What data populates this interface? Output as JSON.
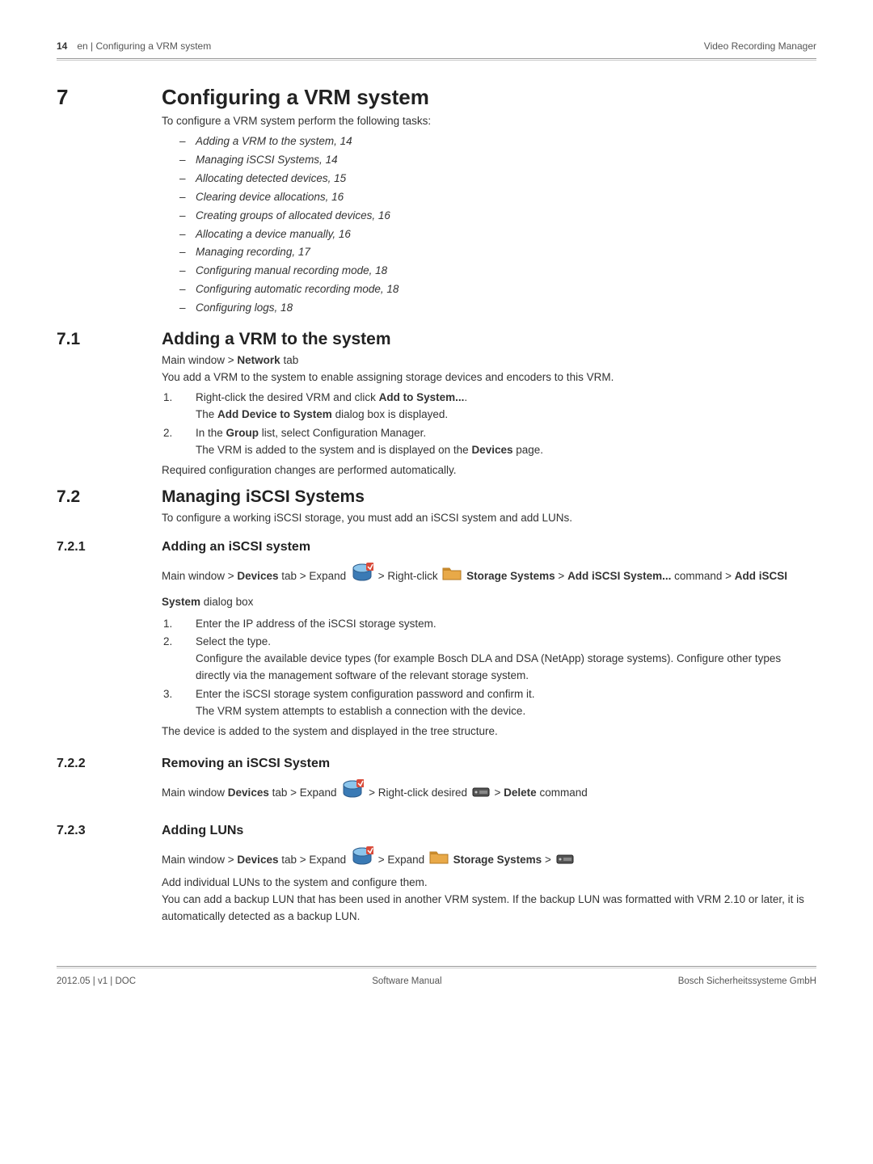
{
  "header": {
    "page_num": "14",
    "left_text": "en | Configuring a VRM system",
    "right_text": "Video Recording Manager"
  },
  "chapter": {
    "num": "7",
    "title": "Configuring a VRM system",
    "intro": "To configure a VRM system perform the following tasks:",
    "tasks": [
      "Adding a VRM to the system, 14",
      "Managing iSCSI Systems, 14",
      "Allocating detected devices, 15",
      "Clearing device allocations, 16",
      "Creating groups of allocated devices, 16",
      "Allocating a device manually, 16",
      "Managing recording, 17",
      "Configuring manual recording mode, 18",
      "Configuring automatic recording mode, 18",
      "Configuring logs, 18"
    ]
  },
  "s71": {
    "num": "7.1",
    "title": "Adding a VRM to the system",
    "path_pre": "Main window > ",
    "path_bold": "Network",
    "path_post": " tab",
    "p1": "You add a VRM to the system to enable assigning storage devices and encoders to this VRM.",
    "li1a": "Right-click the desired VRM and click ",
    "li1b": "Add to System...",
    "li1c": ".",
    "li1sub_a": "The ",
    "li1sub_b": "Add Device to System",
    "li1sub_c": " dialog box is displayed.",
    "li2a": "In the ",
    "li2b": "Group",
    "li2c": " list, select Configuration Manager.",
    "li2sub_a": "The VRM is added to the system and is displayed on the ",
    "li2sub_b": "Devices",
    "li2sub_c": " page.",
    "p2": "Required configuration changes are performed automatically."
  },
  "s72": {
    "num": "7.2",
    "title": "Managing iSCSI Systems",
    "p1": "To configure a working iSCSI storage, you must add an iSCSI system and add LUNs."
  },
  "s721": {
    "num": "7.2.1",
    "title": "Adding an iSCSI system",
    "path_a": "Main window > ",
    "path_b": "Devices",
    "path_c": " tab > Expand ",
    "path_d": " > Right-click ",
    "path_e": "Storage Systems",
    "path_f": " > ",
    "path_g": "Add iSCSI System...",
    "path_h": " command > ",
    "path_i": "Add iSCSI System",
    "path_j": " dialog box",
    "li1": "Enter the IP address of the iSCSI storage system.",
    "li2": "Select the type.",
    "li2sub": "Configure the available device types (for example Bosch DLA and DSA (NetApp) storage systems). Configure other types directly via the management software of the relevant storage system.",
    "li3": "Enter the iSCSI storage system configuration password and confirm it.",
    "li3sub": "The VRM system attempts to establish a connection with the device.",
    "p_end": "The device is added to the system and displayed in the tree structure."
  },
  "s722": {
    "num": "7.2.2",
    "title": "Removing an iSCSI System",
    "path_a": "Main window ",
    "path_b": "Devices",
    "path_c": " tab > Expand ",
    "path_d": " > Right-click desired ",
    "path_e": " > ",
    "path_f": "Delete",
    "path_g": " command"
  },
  "s723": {
    "num": "7.2.3",
    "title": "Adding LUNs",
    "path_a": "Main window > ",
    "path_b": "Devices",
    "path_c": " tab > Expand ",
    "path_d": " > Expand ",
    "path_e": "Storage Systems",
    "path_f": " > ",
    "p1": "Add individual LUNs to the system and configure them.",
    "p2": "You can add a backup LUN that has been used in another VRM system. If the backup LUN was formatted with VRM 2.10 or later, it is automatically detected as a backup LUN."
  },
  "footer": {
    "left": "2012.05 | v1 | DOC",
    "center": "Software Manual",
    "right": "Bosch Sicherheitssysteme GmbH"
  }
}
